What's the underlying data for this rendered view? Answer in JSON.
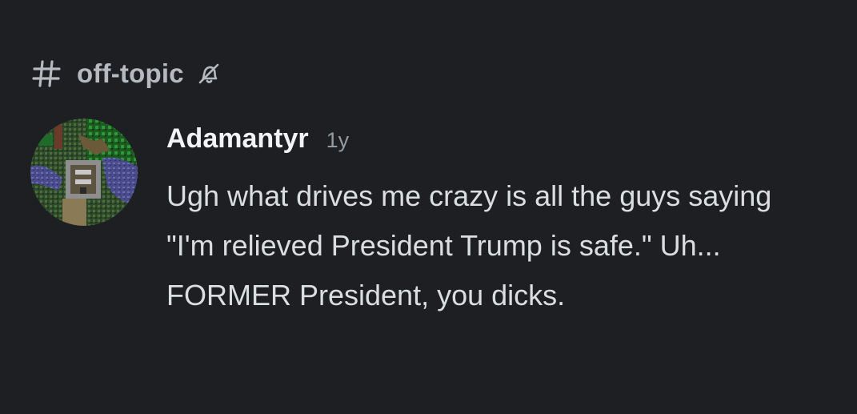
{
  "channel": {
    "icon": "hash-icon",
    "name": "off-topic",
    "muted_icon": "bell-slash-icon"
  },
  "message": {
    "avatar_icon": "pixel-art-map-avatar",
    "author": "Adamantyr",
    "timestamp": "1y",
    "content": "Ugh what drives me crazy is all the guys saying \"I'm relieved President Trump is safe.\" Uh... FORMER President, you dicks."
  },
  "colors": {
    "background": "#1e1f22",
    "channel_text": "#b5bac1",
    "author_text": "#f2f3f5",
    "timestamp_text": "#949ba4",
    "message_text": "#dbdee1"
  }
}
